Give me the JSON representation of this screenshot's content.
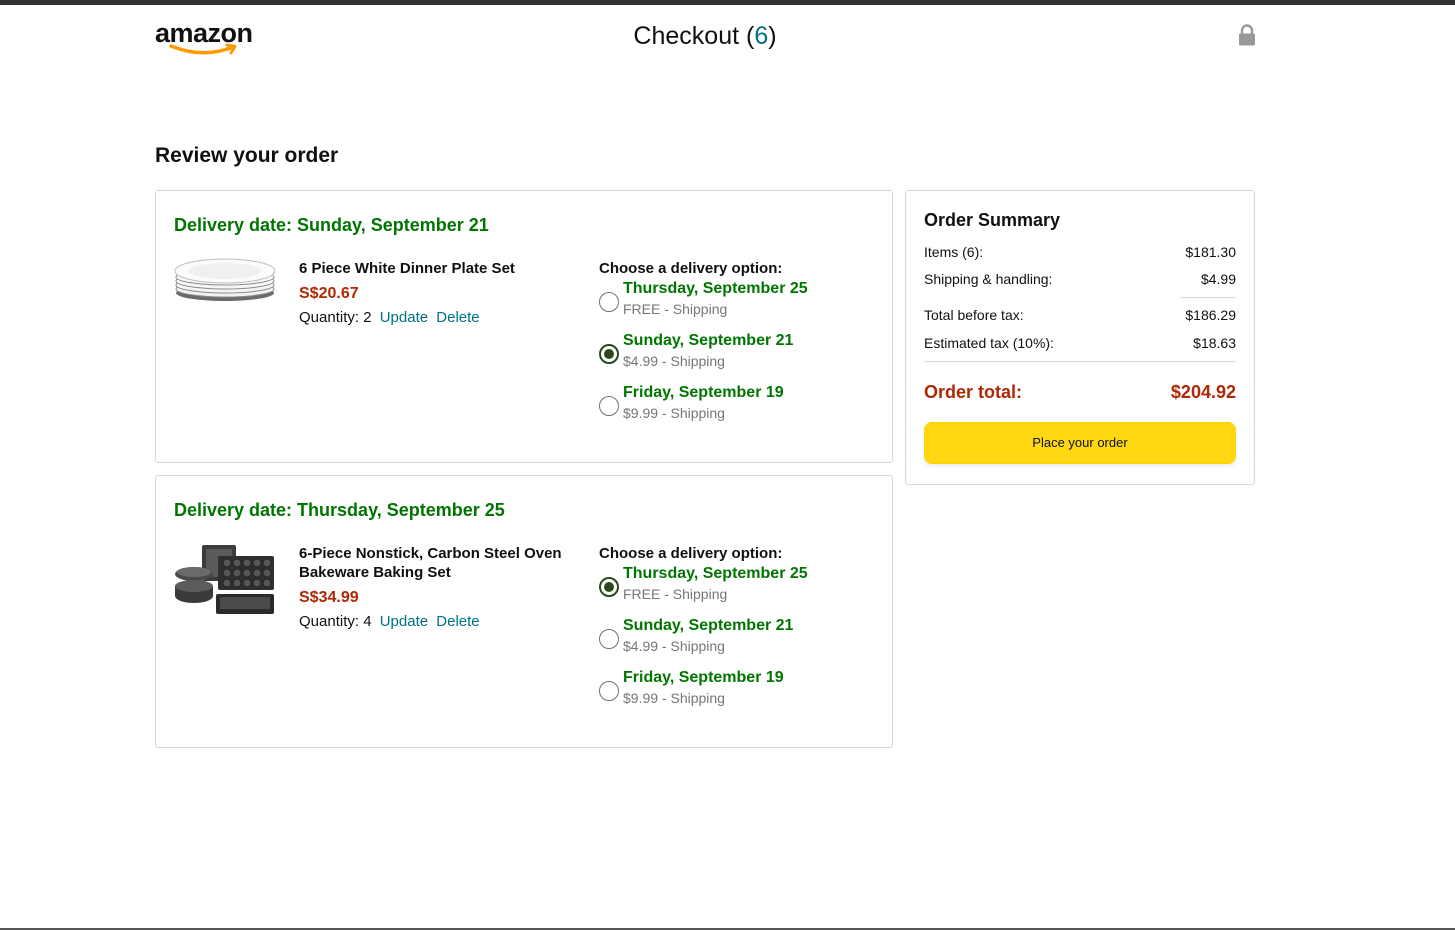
{
  "header": {
    "logo_text": "amazon",
    "checkout_label": "Checkout",
    "checkout_open": "(",
    "checkout_count": "6",
    "checkout_close": ")"
  },
  "page_heading": "Review your order",
  "deliveries": [
    {
      "delivery_date": "Delivery date: Sunday, September 21",
      "product": {
        "title": "6 Piece White Dinner Plate Set",
        "price": "S$20.67",
        "quantity_label": "Quantity: 2",
        "update_label": "Update",
        "delete_label": "Delete",
        "image_icon": "plate-stack-image"
      },
      "options_label": "Choose a delivery option:",
      "options": [
        {
          "date": "Thursday, September 25",
          "shipping": "FREE - Shipping",
          "selected": false
        },
        {
          "date": "Sunday, September 21",
          "shipping": "$4.99 - Shipping",
          "selected": true
        },
        {
          "date": "Friday, September 19",
          "shipping": "$9.99 - Shipping",
          "selected": false
        }
      ]
    },
    {
      "delivery_date": "Delivery date: Thursday, September 25",
      "product": {
        "title": "6-Piece Nonstick, Carbon Steel Oven Bakeware Baking Set",
        "price": "S$34.99",
        "quantity_label": "Quantity: 4",
        "update_label": "Update",
        "delete_label": "Delete",
        "image_icon": "bakeware-set-image"
      },
      "options_label": "Choose a delivery option:",
      "options": [
        {
          "date": "Thursday, September 25",
          "shipping": "FREE - Shipping",
          "selected": true
        },
        {
          "date": "Sunday, September 21",
          "shipping": "$4.99 - Shipping",
          "selected": false
        },
        {
          "date": "Friday, September 19",
          "shipping": "$9.99 - Shipping",
          "selected": false
        }
      ]
    }
  ],
  "summary": {
    "title": "Order Summary",
    "items_label": "Items (6):",
    "items_value": "$181.30",
    "shipping_label": "Shipping & handling:",
    "shipping_value": "$4.99",
    "before_tax_label": "Total before tax:",
    "before_tax_value": "$186.29",
    "tax_label": "Estimated tax (10%):",
    "tax_value": "$18.63",
    "total_label": "Order total:",
    "total_value": "$204.92",
    "place_order_label": "Place your order"
  },
  "colors": {
    "green": "#007600",
    "price_red": "#b12704",
    "link": "#007185",
    "button_yellow": "#ffd814",
    "radio_checked": "#2b4a1b"
  }
}
